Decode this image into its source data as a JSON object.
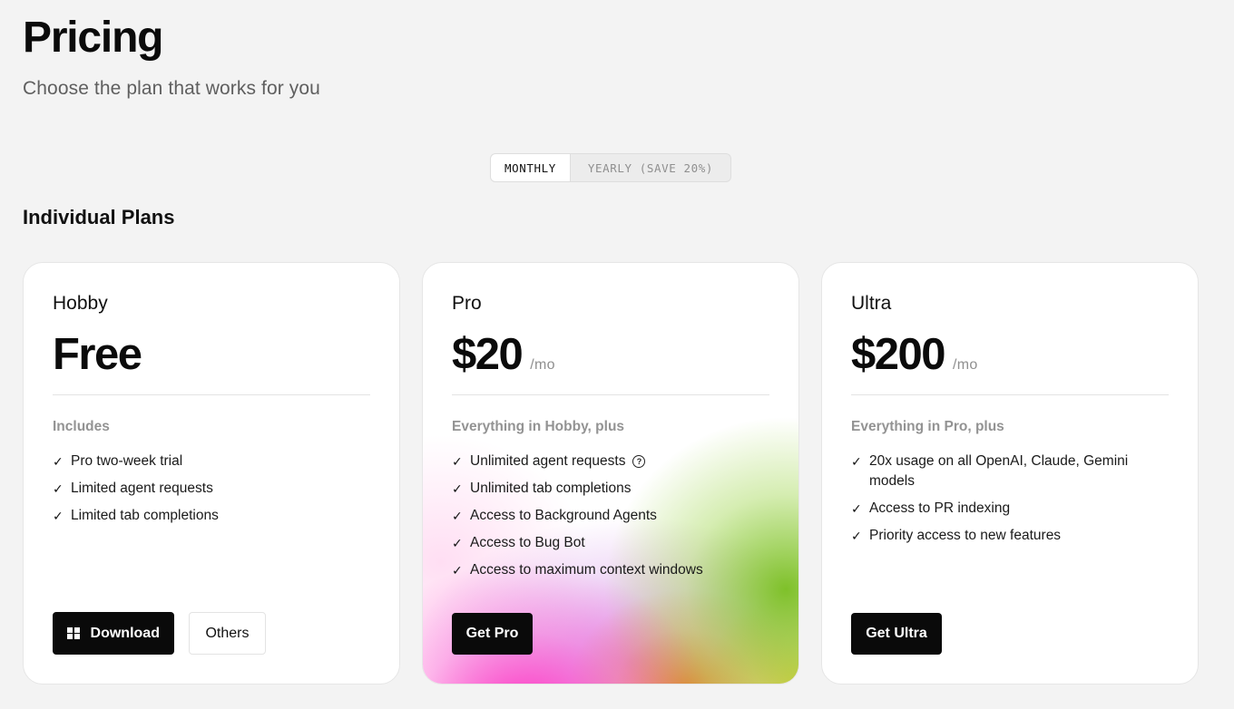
{
  "header": {
    "title": "Pricing",
    "subtitle": "Choose the plan that works for you"
  },
  "billing_toggle": {
    "options": [
      "MONTHLY",
      "YEARLY (SAVE 20%)"
    ],
    "selected": "MONTHLY"
  },
  "section": {
    "title": "Individual Plans"
  },
  "plans": [
    {
      "name": "Hobby",
      "price": "Free",
      "per": "",
      "includes_label": "Includes",
      "features": [
        "Pro two-week trial",
        "Limited agent requests",
        "Limited tab completions"
      ],
      "primary_button": "Download",
      "secondary_button": "Others",
      "primary_icon": "windows-icon"
    },
    {
      "name": "Pro",
      "price": "$20",
      "per": "/mo",
      "includes_label": "Everything in Hobby, plus",
      "features": [
        "Unlimited agent requests",
        "Unlimited tab completions",
        "Access to Background Agents",
        "Access to Bug Bot",
        "Access to maximum context windows"
      ],
      "primary_button": "Get Pro",
      "info_icon_on_feature": 0,
      "gradient_colors": [
        "#ff28be",
        "#78be1e",
        "#e68214",
        "#d7c81e",
        "#be5adc"
      ]
    },
    {
      "name": "Ultra",
      "price": "$200",
      "per": "/mo",
      "includes_label": "Everything in Pro, plus",
      "features": [
        "20x usage on all OpenAI, Claude, Gemini models",
        "Access to PR indexing",
        "Priority access to new features"
      ],
      "primary_button": "Get Ultra"
    }
  ],
  "colors": {
    "background": "#f3f3f3",
    "card": "#ffffff",
    "button_dark": "#0a0a0a",
    "muted_text": "#939393"
  },
  "icons": {
    "check": "check-icon",
    "info": "info-icon"
  }
}
